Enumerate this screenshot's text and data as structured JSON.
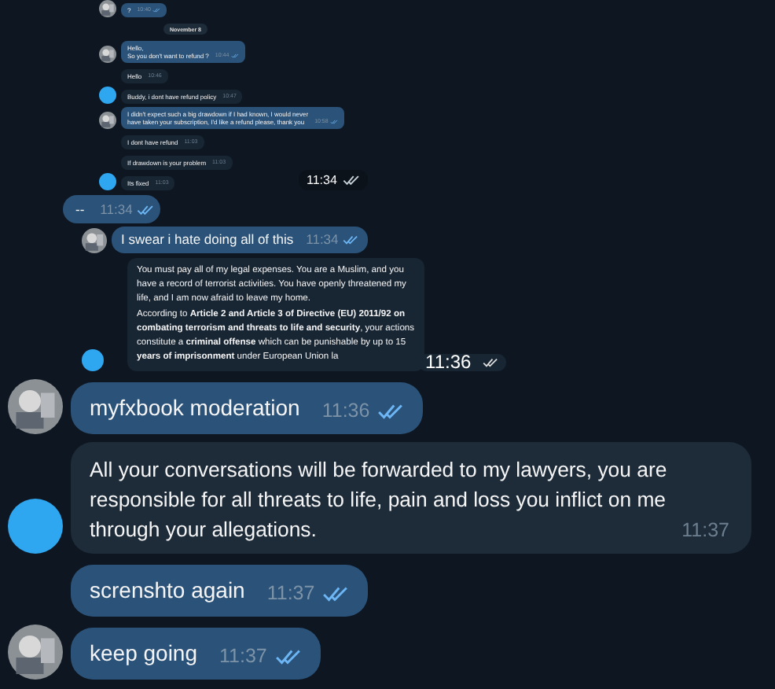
{
  "messages": [
    {
      "kind": "screenshot",
      "overlay_time": "11:34",
      "overlay_read": true,
      "items": [
        {
          "kind": "bubble",
          "outgoing": true,
          "avatar": {
            "kind": "photo"
          },
          "lines": [
            "?"
          ],
          "time": "10:40",
          "read": true
        },
        {
          "kind": "date",
          "text": "November 8"
        },
        {
          "kind": "bubble",
          "outgoing": true,
          "avatar": {
            "kind": "photo"
          },
          "lines": [
            "Hello,",
            "So you don't want to refund ?"
          ],
          "time": "10:44",
          "read": true
        },
        {
          "kind": "bubble",
          "outgoing": false,
          "lines": [
            "Hello"
          ],
          "time": "10:46"
        },
        {
          "kind": "bubble",
          "outgoing": false,
          "avatar": {
            "kind": "dot"
          },
          "lines": [
            "Buddy, i dont have refund policy"
          ],
          "time": "10:47"
        },
        {
          "kind": "bubble",
          "outgoing": true,
          "avatar": {
            "kind": "photo"
          },
          "lines": [
            "I didn't expect such a big drawdown if I had known, I would never",
            "have taken your subscription, I'd like a refund please, thank you"
          ],
          "time": "10:58",
          "read": true
        },
        {
          "kind": "bubble",
          "outgoing": false,
          "lines": [
            "I dont have refund"
          ],
          "time": "11:03"
        },
        {
          "kind": "bubble",
          "outgoing": false,
          "lines": [
            "If drawdown is your problem"
          ],
          "time": "11:03"
        },
        {
          "kind": "bubble",
          "outgoing": false,
          "avatar": {
            "kind": "dot"
          },
          "lines": [
            "Its fixed"
          ],
          "time": "11:03"
        }
      ]
    },
    {
      "kind": "caption",
      "text": "--",
      "time": "11:34",
      "read": true
    },
    {
      "kind": "screenshot2",
      "overlay_time": "11:36",
      "overlay_read": true,
      "items": [
        {
          "kind": "bubble",
          "outgoing": true,
          "avatar": {
            "kind": "photo"
          },
          "lines": [
            "I swear i hate doing all of this"
          ],
          "time": "11:34",
          "read": true
        },
        {
          "kind": "bubble",
          "outgoing": false,
          "avatar": {
            "kind": "dot"
          },
          "lines": [
            "You must pay all of my legal expenses. You are a Muslim, and you",
            "have a record of terrorist activities. You have openly threatened my",
            "life, and I am now afraid to leave my home.",
            "According to **Article 2 and Article 3 of Directive (EU) 2011/92 on**",
            "**combating terrorism and threats to life and security**, your actions",
            "constitute a **criminal offense** which can be punishable by up to 15",
            "**years of imprisonment** under European Union la"
          ]
        }
      ]
    },
    {
      "kind": "text",
      "outgoing": true,
      "avatar": {
        "kind": "photo"
      },
      "text": "myfxbook moderation",
      "time": "11:36",
      "read": true
    },
    {
      "kind": "text",
      "outgoing": false,
      "avatar": {
        "kind": "dot"
      },
      "text": "All your conversations will be forwarded to my lawyers, you are responsible for all threats to life, pain and loss you inflict on me through your allegations.",
      "time": "11:37"
    },
    {
      "kind": "text",
      "outgoing": true,
      "text": "screnshto again",
      "time": "11:37",
      "read": true
    },
    {
      "kind": "text",
      "outgoing": true,
      "avatar": {
        "kind": "photo"
      },
      "text": "keep going",
      "time": "11:37",
      "read": true
    }
  ]
}
